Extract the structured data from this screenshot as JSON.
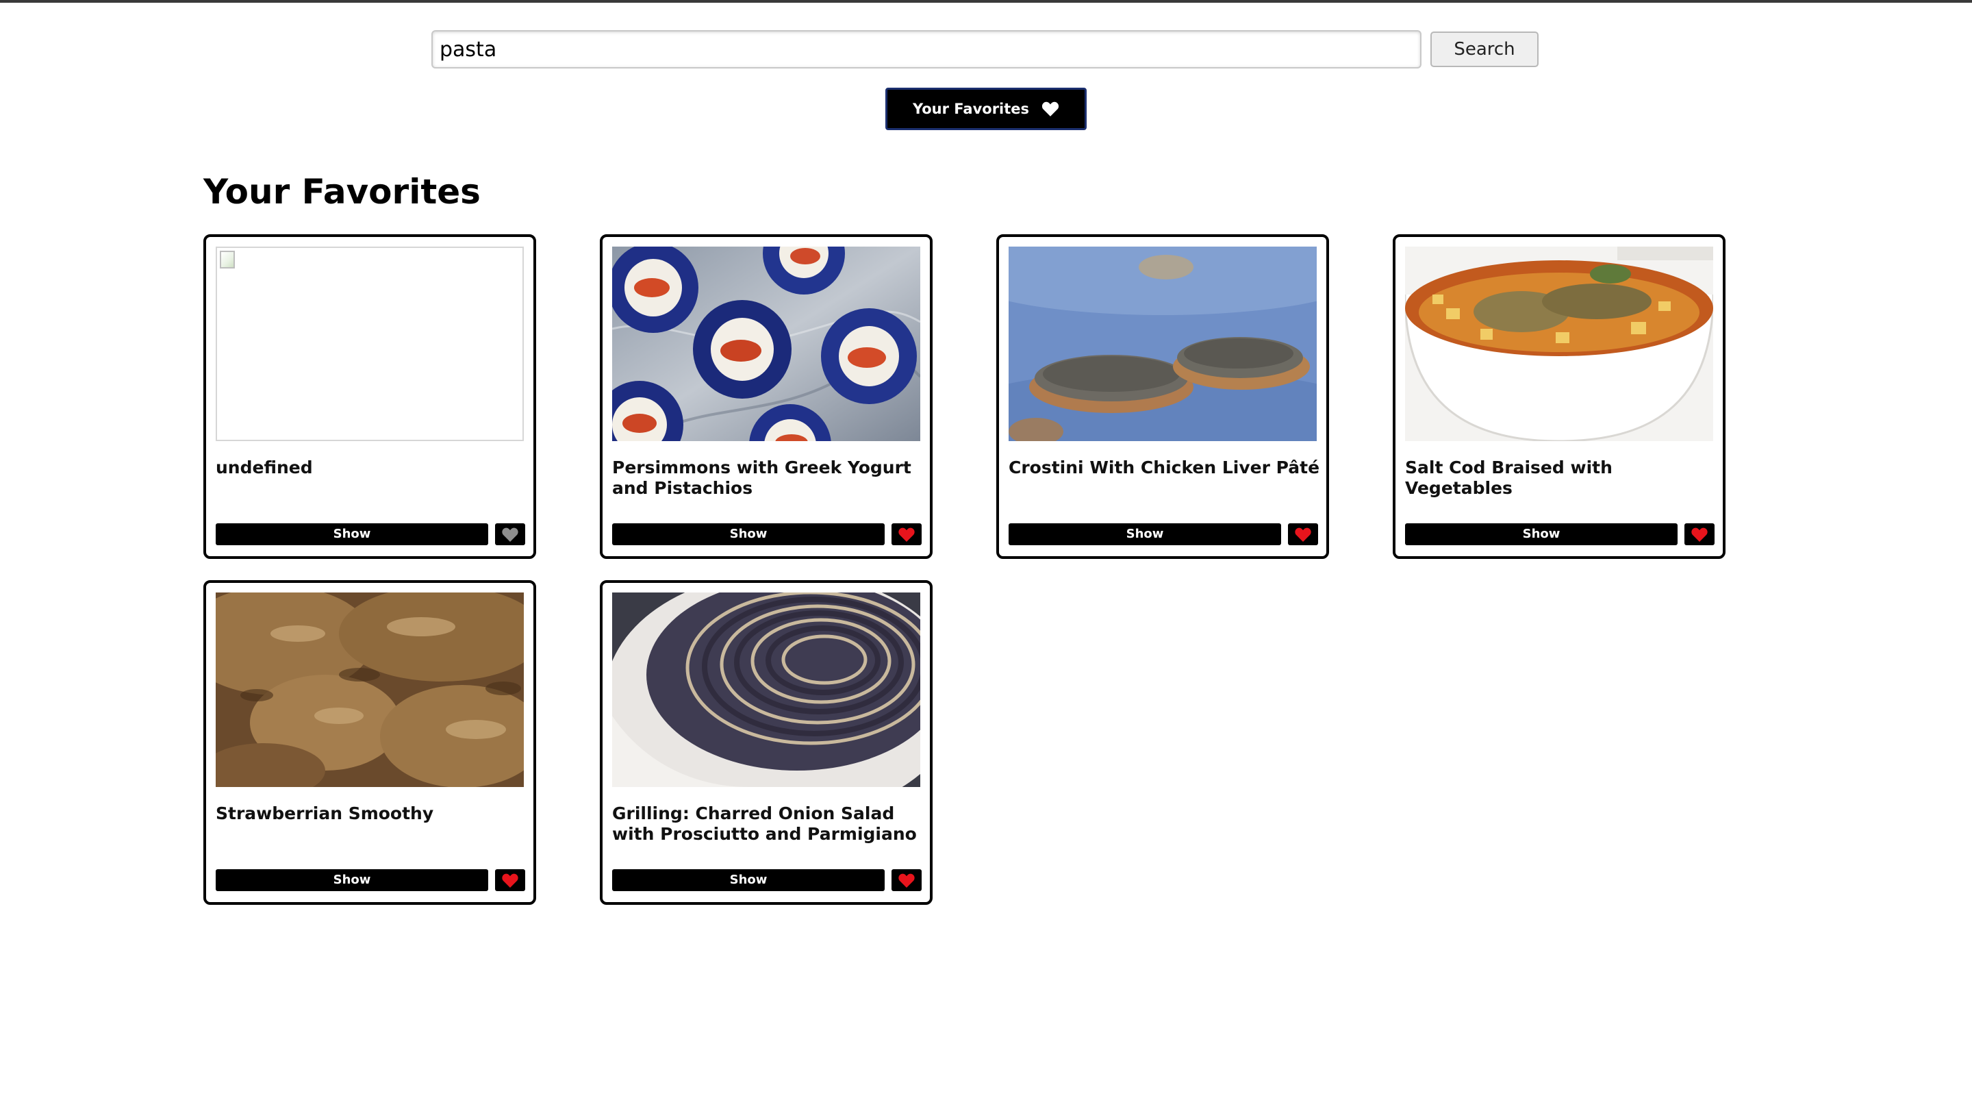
{
  "search": {
    "value": "pasta",
    "button_label": "Search"
  },
  "favorites_toggle": {
    "label": "Your Favorites",
    "icon": "heart-icon"
  },
  "section": {
    "title": "Your Favorites"
  },
  "cards": [
    {
      "title": "undefined",
      "show_label": "Show",
      "favorited": false,
      "image": "broken-image-icon"
    },
    {
      "title": "Persimmons with Greek Yogurt and Pistachios",
      "show_label": "Show",
      "favorited": true,
      "image": "persimmons-photo"
    },
    {
      "title": "Crostini With Chicken Liver Pâté",
      "show_label": "Show",
      "favorited": true,
      "image": "crostini-photo"
    },
    {
      "title": "Salt Cod Braised with Vegetables",
      "show_label": "Show",
      "favorited": true,
      "image": "salt-cod-photo"
    },
    {
      "title": "Strawberrian Smoothy",
      "show_label": "Show",
      "favorited": true,
      "image": "fritters-photo"
    },
    {
      "title": "Grilling: Charred Onion Salad with Prosciutto and Parmigiano",
      "show_label": "Show",
      "favorited": true,
      "image": "charred-onion-photo"
    }
  ],
  "colors": {
    "heart_active": "#e8141c",
    "heart_inactive": "#8e8e8e",
    "button_bg": "#000000",
    "toggle_border": "#1b2f6e"
  }
}
